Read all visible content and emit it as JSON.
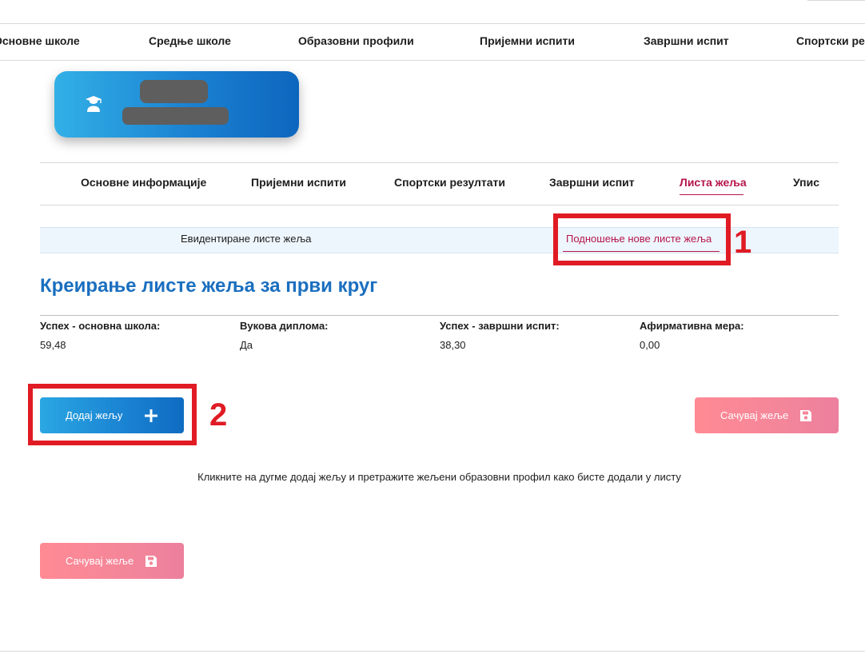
{
  "top_nav": {
    "items": [
      "Основне школе",
      "Средње школе",
      "Образовни профили",
      "Пријемни испити",
      "Завршни испит",
      "Спортски резултати"
    ]
  },
  "profile_card": {
    "icon": "graduate-icon"
  },
  "section_tabs": {
    "items": [
      "Основне информације",
      "Пријемни испити",
      "Спортски резултати",
      "Завршни испит",
      "Листа жеља",
      "Упис"
    ],
    "active": "Листа жеља"
  },
  "sub_tabs": {
    "items": [
      "Евидентиране листе жеља",
      "Подношење нове листе жеља"
    ],
    "active": "Подношење нове листе жеља"
  },
  "annotations": [
    "1",
    "2"
  ],
  "page_title": "Креирање листе жеља за први круг",
  "stats": [
    {
      "label": "Успех - основна школа:",
      "value": "59,48"
    },
    {
      "label": "Вукова диплома:",
      "value": "Да"
    },
    {
      "label": "Успех - завршни испит:",
      "value": "38,30"
    },
    {
      "label": "Афирмативна мера:",
      "value": "0,00"
    }
  ],
  "buttons": {
    "add_wish": "Додај жељу",
    "save_wishes": "Сачувај жеље"
  },
  "hint": "Кликните на дугме додај жељу и претражите жељени образовни профил како бисте додали у листу",
  "colors": {
    "primary_blue": "#1a82d2",
    "title_blue": "#1a6fbf",
    "active_tab": "#b5164a",
    "save_pink": "#f4869a",
    "annotation_red": "#e01b24"
  }
}
